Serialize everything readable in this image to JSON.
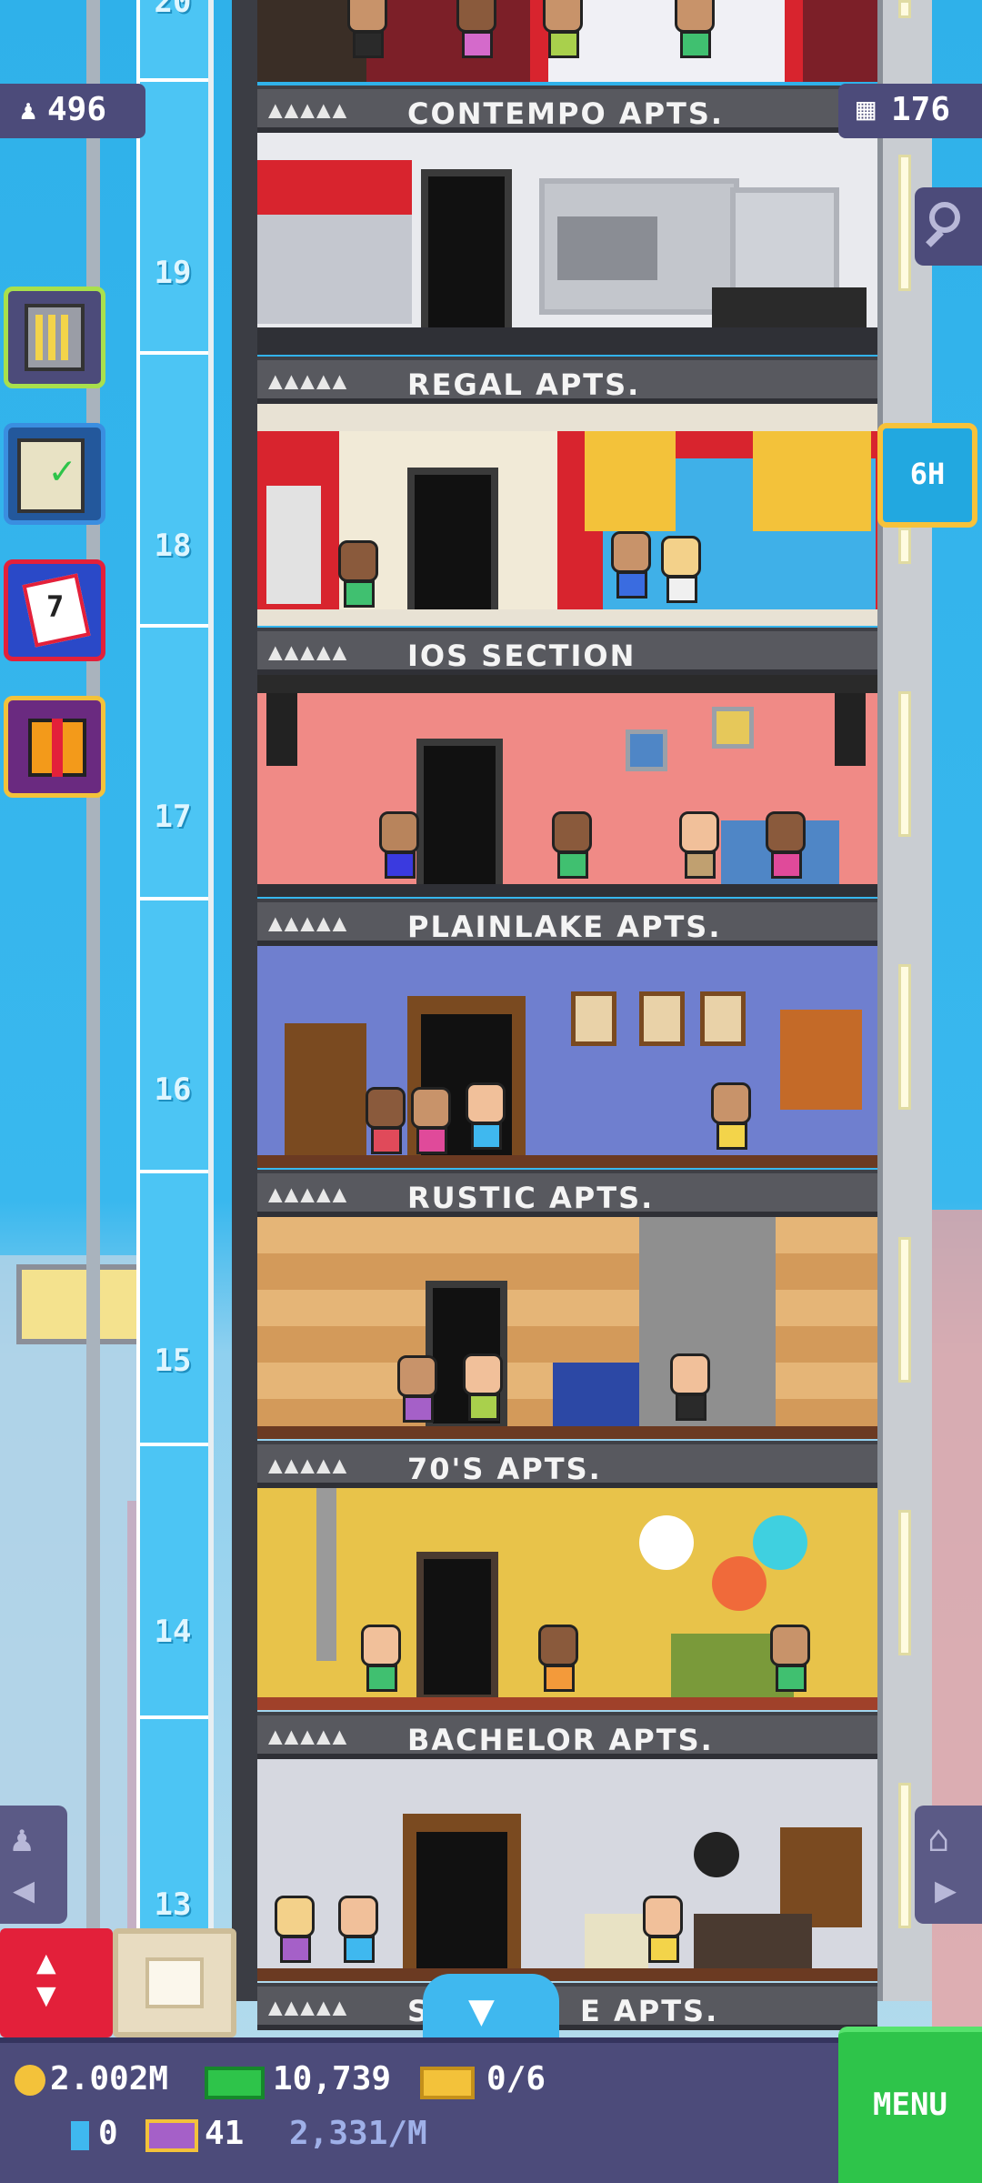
{
  "hud": {
    "population": "496",
    "floors_count": "176",
    "timer_label": "6H"
  },
  "shaft_floor_numbers": [
    "20",
    "19",
    "18",
    "17",
    "16",
    "15",
    "14",
    "13"
  ],
  "floors": [
    {
      "name": "CONTEMPO APTS."
    },
    {
      "name": "REGAL APTS."
    },
    {
      "name": "IOS SECTION"
    },
    {
      "name": "PLAINLAKE APTS."
    },
    {
      "name": "RUSTIC APTS."
    },
    {
      "name": "70'S APTS."
    },
    {
      "name": "BACHELOR APTS."
    },
    {
      "name_left": "S",
      "name_right": "E APTS."
    }
  ],
  "bottom": {
    "coins": "2.002M",
    "bux": "10,739",
    "tickets": "0/6",
    "gems": "0",
    "vip": "41",
    "income": "2,331/M",
    "menu_label": "MENU"
  },
  "colors": {
    "hud_panel": "#4c4b7a",
    "menu_green": "#2ec44a",
    "elevator_red": "#e3203a",
    "timer_blue": "#22a8e0",
    "timer_border": "#f7c23a"
  }
}
